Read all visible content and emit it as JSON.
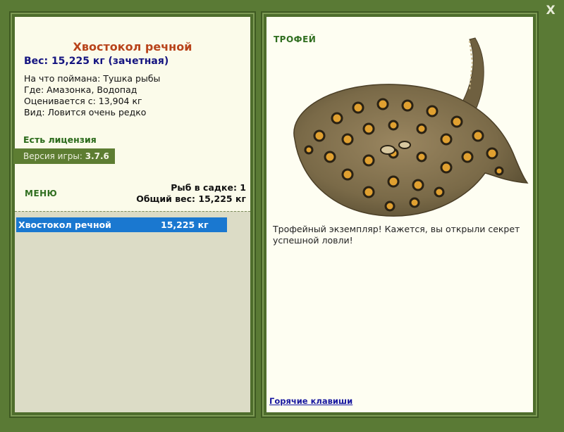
{
  "window": {
    "close_label": "X"
  },
  "fish": {
    "name": "Хвостокол речной",
    "weight_line": "Вес: 15,225 кг (зачетная)",
    "info": [
      "На что поймана: Тушка рыбы",
      "Где: Амазонка, Водопад",
      "Оценивается с: 13,904 кг",
      "Вид: Ловится очень редко"
    ]
  },
  "license": "Есть лицензия",
  "version": {
    "label": "Версия игры: ",
    "number": "3.7.6"
  },
  "menu": {
    "label": "МЕНЮ"
  },
  "keepnet": {
    "count_line": "Рыб в садке: 1",
    "total_line": "Общий вес: 15,225 кг",
    "items": [
      {
        "name": "Хвостокол речной",
        "weight": "15,225 кг"
      }
    ]
  },
  "trophy": {
    "label": "ТРОФЕЙ",
    "image_icon": "stingray-image",
    "text": "Трофейный экземпляр! Кажется, вы открыли секрет успешной ловли!"
  },
  "hotkeys_link": "Горячие клавиши",
  "colors": {
    "background": "#5a7a35",
    "panel": "#fbfbea",
    "title": "#b8431a",
    "weight": "#141480",
    "green_label": "#2f6e1f",
    "selection": "#1a78d0"
  }
}
